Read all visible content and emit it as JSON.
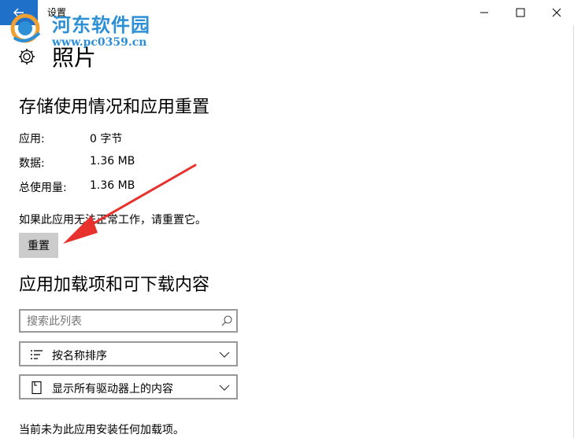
{
  "window": {
    "title": "设置",
    "back_icon": "back-arrow-icon",
    "accent_color": "#1e70c8"
  },
  "watermark": {
    "name": "河东软件园",
    "url": "www.pc0359.cn"
  },
  "page": {
    "title": "照片",
    "icon": "gear-icon"
  },
  "storage": {
    "heading": "存储使用情况和应用重置",
    "rows": [
      {
        "label": "应用:",
        "value": "0 字节"
      },
      {
        "label": "数据:",
        "value": "1.36 MB"
      },
      {
        "label": "总使用量:",
        "value": "1.36 MB"
      }
    ],
    "hint": "如果此应用无法正常工作，请重置它。",
    "reset_label": "重置"
  },
  "addons": {
    "heading": "应用加载项和可下载内容",
    "search_placeholder": "搜索此列表",
    "sort_label": "按名称排序",
    "filter_label": "显示所有驱动器上的内容",
    "empty_text": "当前未为此应用安装任何加载项。"
  },
  "annotation": {
    "arrow_color": "#e8302c"
  }
}
